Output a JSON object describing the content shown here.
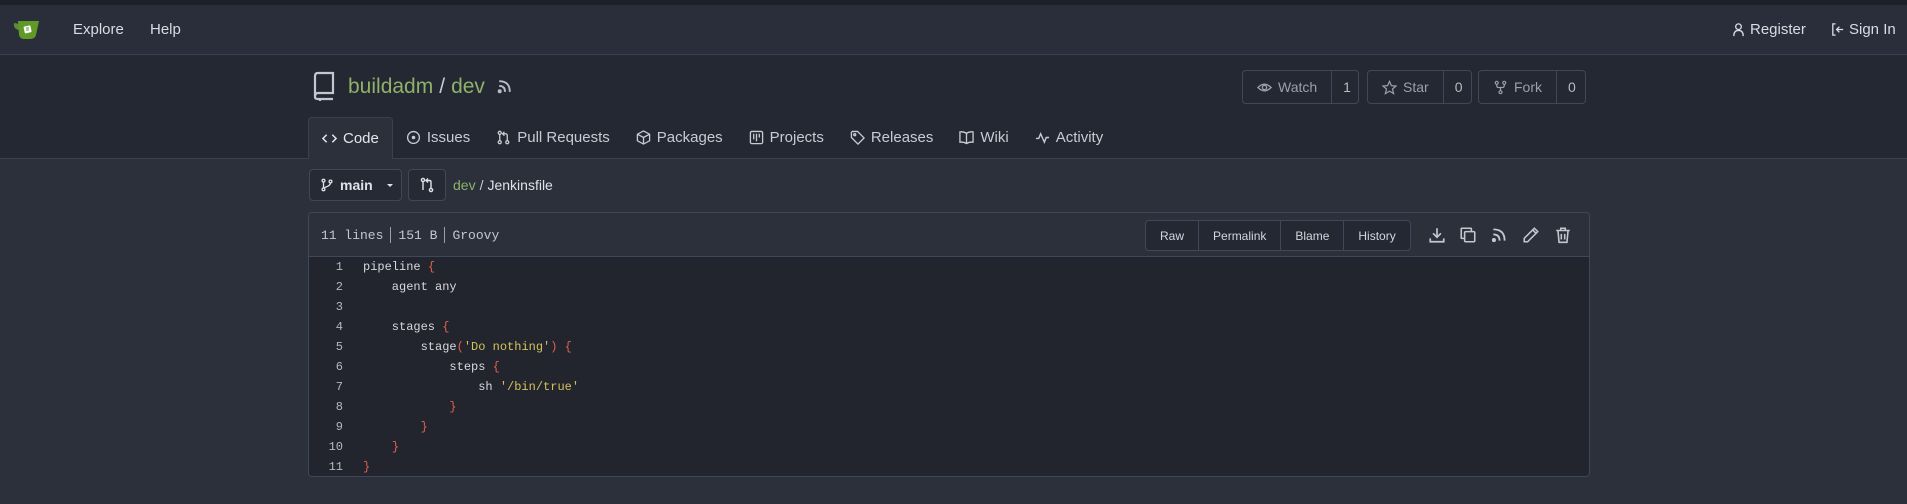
{
  "nav": {
    "explore": "Explore",
    "help": "Help",
    "register": "Register",
    "sign_in": "Sign In"
  },
  "repo": {
    "owner": "buildadm",
    "separator": "/",
    "name": "dev",
    "watch_label": "Watch",
    "watch_count": "1",
    "star_label": "Star",
    "star_count": "0",
    "fork_label": "Fork",
    "fork_count": "0"
  },
  "tabs": [
    {
      "label": "Code",
      "icon": "code-icon",
      "active": true
    },
    {
      "label": "Issues",
      "icon": "issue-icon"
    },
    {
      "label": "Pull Requests",
      "icon": "pull-request-icon"
    },
    {
      "label": "Packages",
      "icon": "package-icon"
    },
    {
      "label": "Projects",
      "icon": "project-icon"
    },
    {
      "label": "Releases",
      "icon": "tag-icon"
    },
    {
      "label": "Wiki",
      "icon": "book-icon"
    },
    {
      "label": "Activity",
      "icon": "pulse-icon"
    }
  ],
  "branch": {
    "name": "main"
  },
  "breadcrumb": {
    "repo": "dev",
    "separator": "/",
    "file": "Jenkinsfile"
  },
  "file": {
    "lines": "11 lines",
    "size": "151 B",
    "language": "Groovy",
    "buttons": {
      "raw": "Raw",
      "permalink": "Permalink",
      "blame": "Blame",
      "history": "History"
    }
  },
  "code": [
    {
      "n": "1",
      "parts": [
        [
          "t",
          "pipeline "
        ],
        [
          "p",
          "{"
        ]
      ]
    },
    {
      "n": "2",
      "parts": [
        [
          "t",
          "    agent any"
        ]
      ]
    },
    {
      "n": "3",
      "parts": []
    },
    {
      "n": "4",
      "parts": [
        [
          "t",
          "    stages "
        ],
        [
          "p",
          "{"
        ]
      ]
    },
    {
      "n": "5",
      "parts": [
        [
          "t",
          "        stage"
        ],
        [
          "p",
          "("
        ],
        [
          "s",
          "'Do nothing'"
        ],
        [
          "p",
          ")"
        ],
        [
          "t",
          " "
        ],
        [
          "p",
          "{"
        ]
      ]
    },
    {
      "n": "6",
      "parts": [
        [
          "t",
          "            steps "
        ],
        [
          "p",
          "{"
        ]
      ]
    },
    {
      "n": "7",
      "parts": [
        [
          "t",
          "                sh "
        ],
        [
          "s",
          "'/bin/true'"
        ]
      ]
    },
    {
      "n": "8",
      "parts": [
        [
          "t",
          "            "
        ],
        [
          "p",
          "}"
        ]
      ]
    },
    {
      "n": "9",
      "parts": [
        [
          "t",
          "        "
        ],
        [
          "p",
          "}"
        ]
      ]
    },
    {
      "n": "10",
      "parts": [
        [
          "t",
          "    "
        ],
        [
          "p",
          "}"
        ]
      ]
    },
    {
      "n": "11",
      "parts": [
        [
          "p",
          "}"
        ]
      ]
    }
  ],
  "colors": {
    "accent_green": "#8fb16a",
    "punctuation": "#e3604a",
    "string": "#d4c25b"
  }
}
